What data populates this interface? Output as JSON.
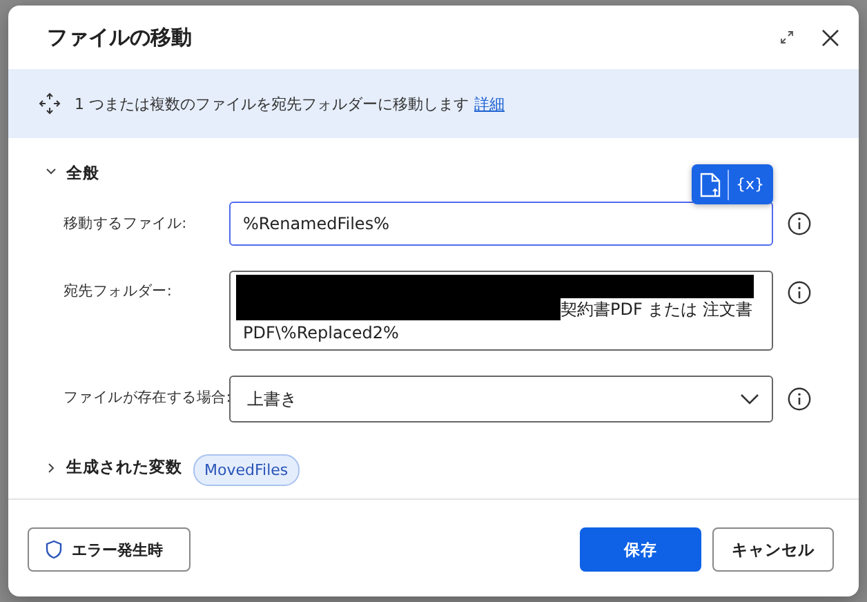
{
  "window": {
    "title": "ファイルの移動"
  },
  "info": {
    "text": "1 つまたは複数のファイルを宛先フォルダーに移動します",
    "link": "詳細"
  },
  "section": {
    "title": "全般",
    "expanded": true
  },
  "toolbar": {
    "variable_label": "{x}"
  },
  "fields": [
    {
      "kind": "text",
      "label": "移動するファイル:",
      "value": "%RenamedFiles%",
      "focused": true
    },
    {
      "kind": "multiline",
      "label": "宛先フォルダー:",
      "redacted": true,
      "lines": [
        "契約書PDF または 注文書",
        "PDF\\%Replaced2%"
      ],
      "focused": false
    },
    {
      "kind": "dropdown",
      "label": "ファイルが存在する場合:",
      "value": "上書き",
      "focused": false
    }
  ],
  "variables": {
    "title": "生成された変数",
    "expanded": false,
    "chips": [
      "MovedFiles"
    ]
  },
  "footer": {
    "error_button": "エラー発生時",
    "buttons": [
      {
        "label": "保存",
        "kind": "primary"
      },
      {
        "label": "キャンセル",
        "kind": "secondary"
      }
    ]
  }
}
